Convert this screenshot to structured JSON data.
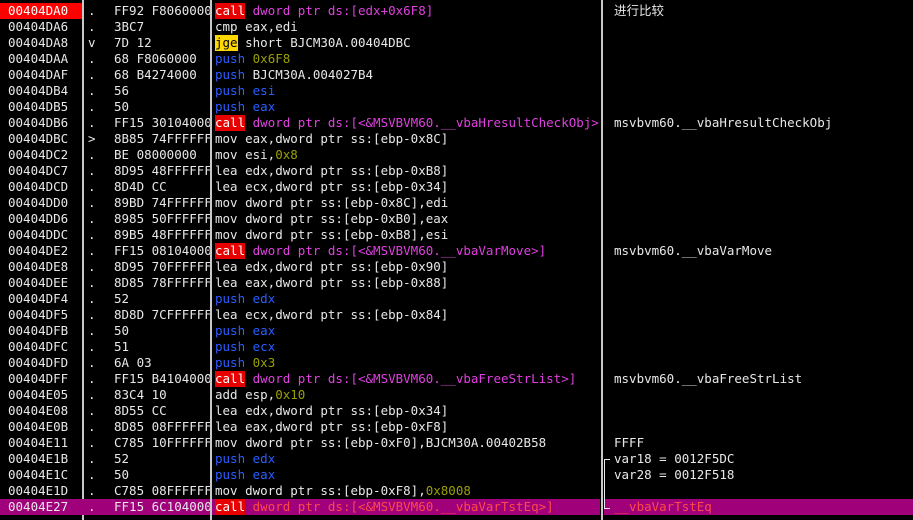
{
  "addresses": [
    "00404DA0",
    "00404DA6",
    "00404DA8",
    "00404DAA",
    "00404DAF",
    "00404DB4",
    "00404DB5",
    "00404DB6",
    "00404DBC",
    "00404DC2",
    "00404DC7",
    "00404DCD",
    "00404DD0",
    "00404DD6",
    "00404DDC",
    "00404DE2",
    "00404DE8",
    "00404DEE",
    "00404DF4",
    "00404DF5",
    "00404DFB",
    "00404DFC",
    "00404DFD",
    "00404DFF",
    "00404E05",
    "00404E08",
    "00404E0B",
    "00404E11",
    "00404E1B",
    "00404E1C",
    "00404E1D",
    "00404E27"
  ],
  "marks": [
    ".",
    ".",
    "v",
    ".",
    ".",
    ".",
    ".",
    ".",
    ">",
    ".",
    ".",
    ".",
    ".",
    ".",
    ".",
    ".",
    ".",
    ".",
    ".",
    ".",
    ".",
    ".",
    ".",
    ".",
    ".",
    ".",
    ".",
    ".",
    ".",
    ".",
    ".",
    "."
  ],
  "hex": [
    "FF92 F8060000",
    "3BC7",
    "7D 12",
    "68 F8060000",
    "68 B4274000",
    "56",
    "50",
    "FF15 30104000",
    "8B85 74FFFFFF",
    "BE 08000000",
    "8D95 48FFFFFF",
    "8D4D CC",
    "89BD 74FFFFFF",
    "8985 50FFFFFF",
    "89B5 48FFFFFF",
    "FF15 08104000",
    "8D95 70FFFFFF",
    "8D85 78FFFFFF",
    "52",
    "8D8D 7CFFFFFF",
    "50",
    "51",
    "6A 03",
    "FF15 B4104000",
    "83C4 10",
    "8D55 CC",
    "8D85 08FFFFFF",
    "C785 10FFFFFF",
    "52",
    "50",
    "C785 08FFFFFF",
    "FF15 6C104000"
  ],
  "mnemonics": [
    "call",
    "cmp",
    "jge",
    "push",
    "push",
    "push",
    "push",
    "call",
    "mov",
    "mov",
    "lea",
    "lea",
    "mov",
    "mov",
    "mov",
    "call",
    "lea",
    "lea",
    "push",
    "lea",
    "push",
    "push",
    "push",
    "call",
    "add",
    "lea",
    "lea",
    "mov",
    "push",
    "push",
    "mov",
    "call"
  ],
  "mnemonic_styles": [
    "call",
    "cmp",
    "jcc",
    "push",
    "push",
    "push",
    "push",
    "call",
    "mov",
    "mov",
    "lea",
    "lea",
    "mov",
    "mov",
    "mov",
    "call",
    "lea",
    "lea",
    "push",
    "lea",
    "push",
    "push",
    "push",
    "call",
    "add",
    "lea",
    "lea",
    "mov",
    "push",
    "push",
    "mov",
    "call"
  ],
  "operands": [
    [
      {
        "t": "dword ptr ds:[edx+0x6F8]",
        "s": "call"
      }
    ],
    [
      {
        "t": "eax,edi",
        "s": "plain"
      }
    ],
    [
      {
        "t": "short BJCM30A.00404DBC",
        "s": "plain"
      }
    ],
    [
      {
        "t": "0x6F8",
        "s": "num"
      }
    ],
    [
      {
        "t": "BJCM30A.004027B4",
        "s": "plain"
      }
    ],
    [
      {
        "t": "esi",
        "s": "push"
      }
    ],
    [
      {
        "t": "eax",
        "s": "push"
      }
    ],
    [
      {
        "t": "dword ptr ds:[<&MSVBVM60.__vbaHresultCheckObj>]",
        "s": "call"
      }
    ],
    [
      {
        "t": "eax,dword ptr ss:[ebp-0x8C]",
        "s": "plain"
      }
    ],
    [
      {
        "t": "esi,",
        "s": "plain"
      },
      {
        "t": "0x8",
        "s": "num"
      }
    ],
    [
      {
        "t": "edx,dword ptr ss:[ebp-0xB8]",
        "s": "plain"
      }
    ],
    [
      {
        "t": "ecx,dword ptr ss:[ebp-0x34]",
        "s": "plain"
      }
    ],
    [
      {
        "t": "dword ptr ss:[ebp-0x8C],edi",
        "s": "plain"
      }
    ],
    [
      {
        "t": "dword ptr ss:[ebp-0xB0],eax",
        "s": "plain"
      }
    ],
    [
      {
        "t": "dword ptr ss:[ebp-0xB8],esi",
        "s": "plain"
      }
    ],
    [
      {
        "t": "dword ptr ds:[<&MSVBVM60.__vbaVarMove>]",
        "s": "call"
      }
    ],
    [
      {
        "t": "edx,dword ptr ss:[ebp-0x90]",
        "s": "plain"
      }
    ],
    [
      {
        "t": "eax,dword ptr ss:[ebp-0x88]",
        "s": "plain"
      }
    ],
    [
      {
        "t": "edx",
        "s": "push"
      }
    ],
    [
      {
        "t": "ecx,dword ptr ss:[ebp-0x84]",
        "s": "plain"
      }
    ],
    [
      {
        "t": "eax",
        "s": "push"
      }
    ],
    [
      {
        "t": "ecx",
        "s": "push"
      }
    ],
    [
      {
        "t": "0x3",
        "s": "num"
      }
    ],
    [
      {
        "t": "dword ptr ds:[<&MSVBVM60.__vbaFreeStrList>]",
        "s": "call"
      }
    ],
    [
      {
        "t": "esp,",
        "s": "plain"
      },
      {
        "t": "0x10",
        "s": "num"
      }
    ],
    [
      {
        "t": "edx,dword ptr ss:[ebp-0x34]",
        "s": "plain"
      }
    ],
    [
      {
        "t": "eax,dword ptr ss:[ebp-0xF8]",
        "s": "plain"
      }
    ],
    [
      {
        "t": "dword ptr ss:[ebp-0xF0],BJCM30A.00402B58",
        "s": "plain"
      }
    ],
    [
      {
        "t": "edx",
        "s": "push"
      }
    ],
    [
      {
        "t": "eax",
        "s": "push"
      }
    ],
    [
      {
        "t": "dword ptr ss:[ebp-0xF8],",
        "s": "plain"
      },
      {
        "t": "0x8008",
        "s": "num"
      }
    ],
    [
      {
        "t": "dword ptr ds:[<&MSVBVM60.__vbaVarTstEq>]",
        "s": "call"
      }
    ]
  ],
  "comments": [
    "进行比较",
    "",
    "",
    "",
    "",
    "",
    "",
    "msvbvm60.__vbaHresultCheckObj",
    "",
    "",
    "",
    "",
    "",
    "",
    "",
    "msvbvm60.__vbaVarMove",
    "",
    "",
    "",
    "",
    "",
    "",
    "",
    "msvbvm60.__vbaFreeStrList",
    "",
    "",
    "",
    "FFFF",
    "var18 = 0012F5DC",
    "var28 = 0012F518",
    "",
    "__vbaVarTstEq"
  ],
  "brace_start_row": 28,
  "brace_end_row": 31,
  "selected_row": 31,
  "colors": {
    "background": "#000000",
    "first_address_bg": "#ff0000",
    "selected_row_bg": "#a0007a",
    "call_bg": "#e60000",
    "jcc_bg": "#ffd800",
    "push_color": "#2b5eff",
    "call_operand_color": "#e040e0",
    "number_color": "#9aa000"
  }
}
